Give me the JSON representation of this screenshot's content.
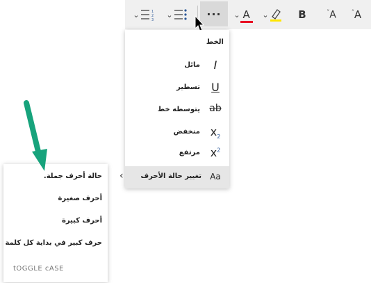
{
  "toolbar": {
    "more_label": "···",
    "increase_font": "A",
    "decrease_font": "A",
    "bold": "B",
    "highlight_color": "#ffe600",
    "font_color": "#e81123"
  },
  "font_menu": {
    "header": "الخط",
    "items": [
      {
        "label": "مائل",
        "icon": "I"
      },
      {
        "label": "تسطير",
        "icon": "U"
      },
      {
        "label": "يتوسطه خط",
        "icon": "ab"
      },
      {
        "label": "منخفض",
        "icon": "x"
      },
      {
        "label": "مرتفع",
        "icon": "x"
      },
      {
        "label": "تغيير حالة الأحرف",
        "icon": "Aa"
      }
    ]
  },
  "case_menu": {
    "items": [
      "حالة أحرف جملة.",
      "أحرف صغيرة",
      "أحرف كبيرة",
      "حرف كبير في بداية كل كلمة"
    ],
    "toggle": "tOGGLE cASE"
  }
}
